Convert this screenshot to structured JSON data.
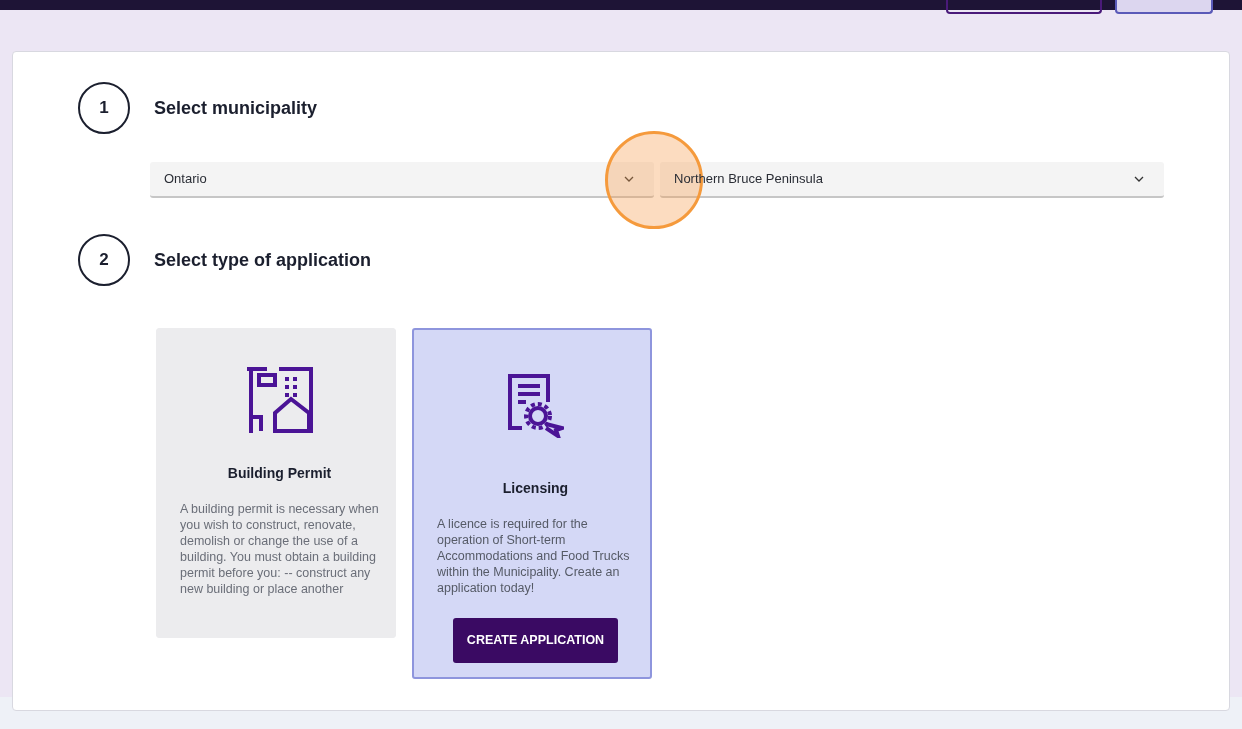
{
  "steps": [
    {
      "number": "1",
      "title": "Select municipality"
    },
    {
      "number": "2",
      "title": "Select type of application"
    }
  ],
  "selects": [
    {
      "value": "Ontario"
    },
    {
      "value": "Northern Bruce Peninsula"
    }
  ],
  "click_marker": {
    "shown": true
  },
  "application_types": [
    {
      "kind": "building",
      "title": "Building Permit",
      "description": "A building permit is necessary when you wish to construct, renovate, demolish or change the use of a building. You must obtain a building permit before you: -- construct any new building or place another",
      "selected": false
    },
    {
      "kind": "licence",
      "title": "Licensing",
      "description": "A licence is required for the operation of Short-term Accommodations and Food Trucks within the Municipality. Create an application today!",
      "selected": true,
      "button": "CREATE APPLICATION"
    }
  ]
}
